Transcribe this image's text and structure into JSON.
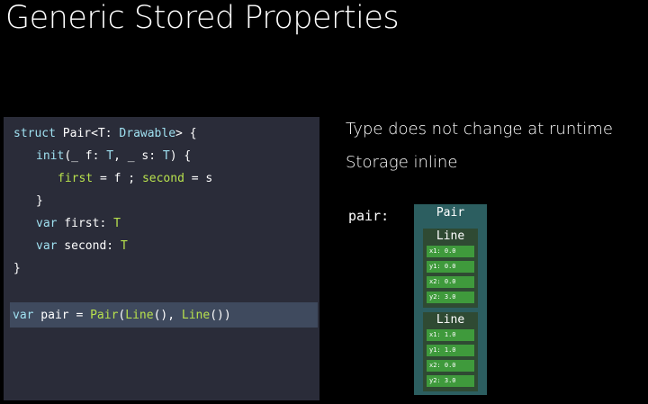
{
  "slide": {
    "title": "Generic Stored Properties"
  },
  "code": {
    "l1": {
      "a": "struct",
      "b": " Pair<T: ",
      "c": "Drawable",
      "d": "> {"
    },
    "l2": {
      "a": "init",
      "b": "(_ f: ",
      "c": "T",
      "d": ", _ s: ",
      "e": "T",
      "f": ") {"
    },
    "l3": {
      "a": "first",
      "b": " = f ; ",
      "c": "second",
      "d": " = s"
    },
    "l4": "}",
    "l5": {
      "a": "var",
      "b": " first: ",
      "c": "T"
    },
    "l6": {
      "a": "var",
      "b": " second: ",
      "c": "T"
    },
    "l7": "}",
    "l8": {
      "a": "var",
      "b": " pair = ",
      "c": "Pair",
      "d": "(",
      "e": "Line",
      "f": "(), ",
      "g": "Line",
      "h": "())"
    }
  },
  "bullets": [
    "Type does not change at runtime",
    "Storage inline"
  ],
  "diagram": {
    "variable_label": "pair:",
    "pair_title": "Pair",
    "lines": [
      {
        "title": "Line",
        "fields": [
          "x1: 0.0",
          "y1: 0.0",
          "x2: 0.0",
          "y2: 3.0"
        ]
      },
      {
        "title": "Line",
        "fields": [
          "x1: 1.0",
          "y1: 1.0",
          "x2: 0.0",
          "y2: 3.0"
        ]
      }
    ]
  },
  "colors": {
    "background": "#000000",
    "code_panel": "#2a2c39",
    "highlight_row": "#3f4a5e",
    "keyword": "#9fe0f0",
    "type": "#b7e04d",
    "pair_box": "#2c5e60",
    "line_box": "#2f4a33",
    "field": "#3f9a3c"
  }
}
